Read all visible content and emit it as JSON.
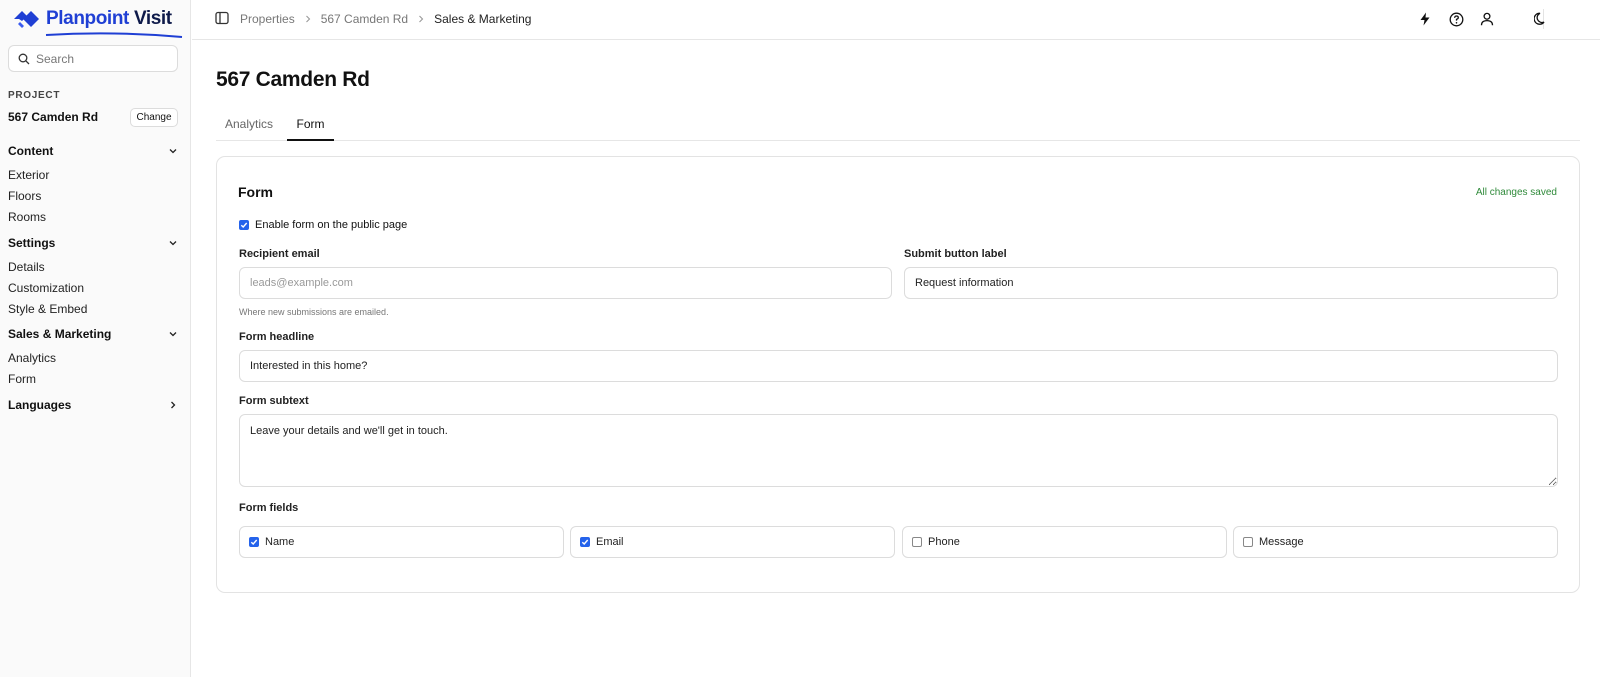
{
  "brand": {
    "name_part1": "Planpoint",
    "name_part2": "Visit",
    "primary_color": "#1f3fd4",
    "dark_color": "#0e1a4a"
  },
  "sidebar": {
    "search_placeholder": "Search",
    "project_label": "PROJECT",
    "project_name": "567 Camden Rd",
    "change_label": "Change",
    "groups": [
      {
        "label": "Content",
        "expanded": true,
        "items": [
          "Exterior",
          "Floors",
          "Rooms"
        ]
      },
      {
        "label": "Settings",
        "expanded": true,
        "items": [
          "Details",
          "Customization",
          "Style & Embed"
        ]
      },
      {
        "label": "Sales & Marketing",
        "expanded": true,
        "items": [
          "Analytics",
          "Form"
        ]
      },
      {
        "label": "Languages",
        "expanded": false,
        "items": []
      }
    ]
  },
  "topbar": {
    "breadcrumbs": [
      "Properties",
      "567 Camden Rd",
      "Sales & Marketing"
    ],
    "icons": [
      "lightning-icon",
      "help-icon",
      "user-icon",
      "moon-icon"
    ]
  },
  "main": {
    "title": "567 Camden Rd",
    "tabs": [
      {
        "label": "Analytics",
        "active": false
      },
      {
        "label": "Form",
        "active": true
      }
    ],
    "form_card": {
      "title": "Form",
      "status": "All changes saved",
      "status_color": "#2f8a3a",
      "enable_label": "Enable form on the public page",
      "enable_checked": true,
      "recipient_label": "Recipient email",
      "recipient_placeholder": "leads@example.com",
      "recipient_value": "",
      "recipient_hint": "Where new submissions are emailed.",
      "submit_label": "Submit button label",
      "submit_value": "Request information",
      "headline_label": "Form headline",
      "headline_value": "Interested in this home?",
      "subtext_label": "Form subtext",
      "subtext_value": "Leave your details and we'll get in touch.",
      "fields_label": "Form fields",
      "fields": [
        {
          "label": "Name",
          "checked": true
        },
        {
          "label": "Email",
          "checked": true
        },
        {
          "label": "Phone",
          "checked": false
        },
        {
          "label": "Message",
          "checked": false
        }
      ],
      "checkbox_color": "#2563eb"
    }
  }
}
